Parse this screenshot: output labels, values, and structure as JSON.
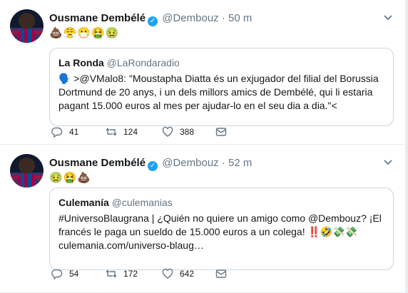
{
  "tweets": [
    {
      "name": "Ousmane Dembélé",
      "handle": "@Dembouz",
      "separator": "·",
      "time": "50 m",
      "emojis": "💩😤😷🤮🤢",
      "quote": {
        "name": "La Ronda",
        "handle": "@LaRondaradio",
        "text": "🗣️ >@VMalo8: \"Moustapha Diatta és un exjugador del filial del Borussia Dortmund de 20 anys, i un dels millors amics de Dembélé, qui li estaria pagant 15.000 euros al mes per ajudar-lo en el seu dia a dia.\"<"
      },
      "replies": "41",
      "retweets": "124",
      "likes": "388"
    },
    {
      "name": "Ousmane Dembélé",
      "handle": "@Dembouz",
      "separator": "·",
      "time": "52 m",
      "emojis": "🤢🤮💩",
      "quote": {
        "name": "Culemanía",
        "handle": "@culemanias",
        "text": "#UniversoBlaugrana | ¿Quién no quiere un amigo como @Dembouz? ¡El francés le paga un sueldo de 15.000 euros a un colega! ‼️🤣💸💸 culemania.com/universo-blaug…"
      },
      "replies": "54",
      "retweets": "172",
      "likes": "642"
    }
  ],
  "icons": [
    "verified-icon",
    "chevron-down-icon",
    "reply-icon",
    "retweet-icon",
    "like-icon",
    "direct-message-icon"
  ]
}
